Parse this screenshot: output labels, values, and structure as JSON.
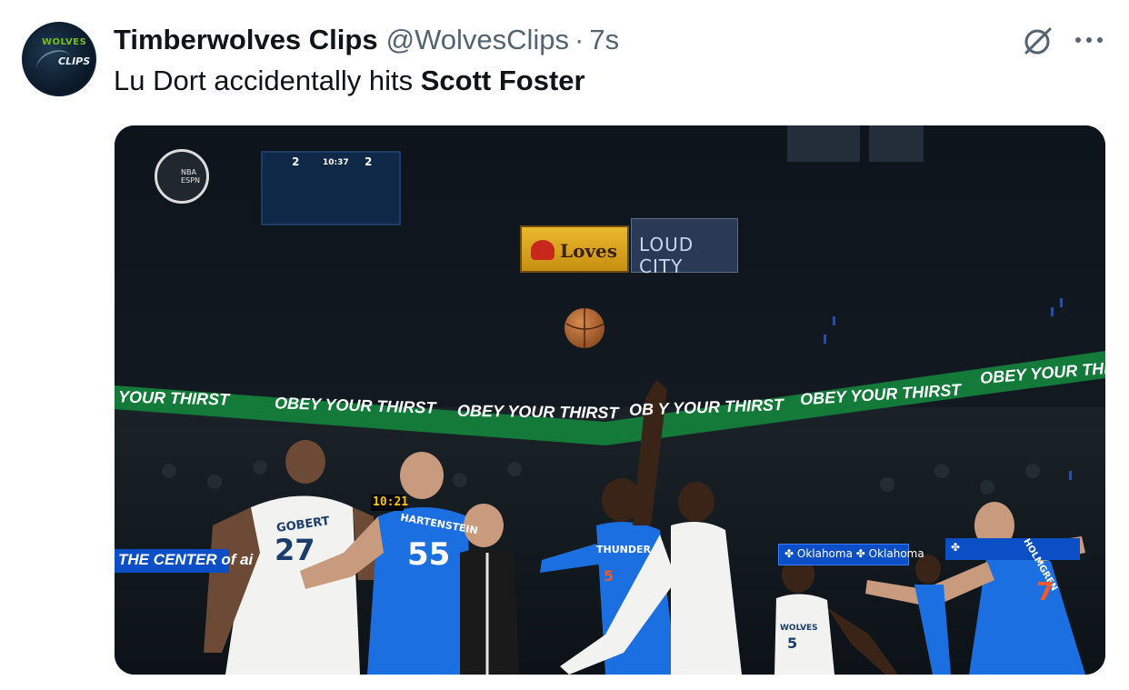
{
  "tweet": {
    "avatar_text_1": "WOLVES",
    "avatar_text_2": "CLIPS",
    "display_name": "Timberwolves Clips",
    "handle": "@WolvesClips",
    "separator": "·",
    "time": "7s",
    "text_plain": "Lu Dort accidentally hits ",
    "text_bold": "Scott Foster",
    "icons": [
      "grok-icon",
      "more-options-icon"
    ]
  },
  "media": {
    "broadcast_logo_text": "NBA\nESPN",
    "scoreboard": {
      "left_score": "2",
      "clock": "10:37",
      "right_score": "2"
    },
    "arena_signs": {
      "loves": "Loves",
      "loud_city": "LOUD CITY"
    },
    "banner_text": [
      "YOUR THIRST",
      "OBEY YOUR THIRST",
      "OBEY YOUR THIRST",
      "OB  Y YOUR THIRST",
      "OBEY YOUR THIRST",
      "OBEY YOUR THIF"
    ],
    "led_left": "THE CENTER of ai",
    "shot_clock": "10:21",
    "led_oklahoma": "✤ Oklahoma ✤ Oklahoma",
    "led_oklahoma_2": "✤",
    "players": {
      "gobert_name": "GOBERT",
      "gobert_num": "27",
      "hartenstein_name": "HARTENSTEIN",
      "hartenstein_num": "55",
      "thunder_wordmark": "THUNDER",
      "thunder_num": "5",
      "wolves_wordmark": "WOLVES",
      "wolves_num": "5",
      "holmgren_name": "HOLMGREN",
      "holmgren_num": "7"
    }
  }
}
